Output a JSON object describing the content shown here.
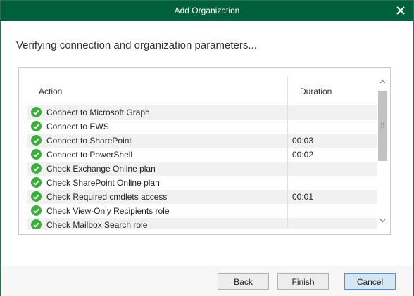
{
  "window": {
    "title": "Add Organization",
    "title_bar_color": "#005f3c"
  },
  "heading": "Verifying connection and organization parameters...",
  "table": {
    "columns": [
      "Action",
      "Duration"
    ],
    "rows": [
      {
        "action": "Connect to Microsoft Graph",
        "duration": "",
        "status": "success"
      },
      {
        "action": "Connect to EWS",
        "duration": "",
        "status": "success"
      },
      {
        "action": "Connect to SharePoint",
        "duration": "00:03",
        "status": "success"
      },
      {
        "action": "Connect to PowerShell",
        "duration": "00:02",
        "status": "success"
      },
      {
        "action": "Check Exchange Online plan",
        "duration": "",
        "status": "success"
      },
      {
        "action": "Check SharePoint Online plan",
        "duration": "",
        "status": "success"
      },
      {
        "action": "Check Required cmdlets access",
        "duration": "00:01",
        "status": "success"
      },
      {
        "action": "Check View-Only Recipients role",
        "duration": "",
        "status": "success"
      },
      {
        "action": "Check Mailbox Search role",
        "duration": "",
        "status": "success"
      }
    ],
    "success_color": "#3cae3c"
  },
  "buttons": {
    "back": "Back",
    "finish": "Finish",
    "cancel": "Cancel"
  },
  "icons": {
    "close": "close-icon",
    "check": "check-circle-icon",
    "scroll_up": "chevron-up-icon",
    "scroll_down": "chevron-down-icon"
  }
}
